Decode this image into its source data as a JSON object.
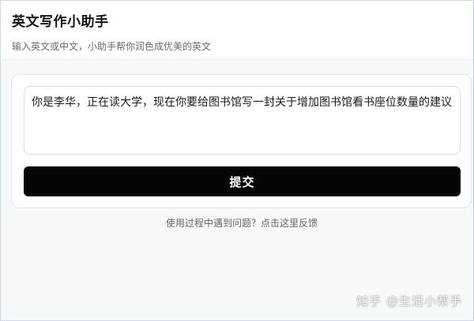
{
  "header": {
    "title": "英文写作小助手",
    "subtitle": "输入英文或中文，小助手帮你润色成优美的英文"
  },
  "form": {
    "input_value": "你是李华，正在读大学，现在你要给图书馆写一封关于增加图书馆看书座位数量的建议",
    "submit_label": "提交"
  },
  "footer": {
    "feedback_text": "使用过程中遇到问题？点击这里反馈"
  },
  "watermark": {
    "text": "知乎 @生活小帮手"
  },
  "colors": {
    "button_bg": "#050505",
    "page_bg": "#f7f8fa",
    "card_bg": "#ffffff"
  }
}
